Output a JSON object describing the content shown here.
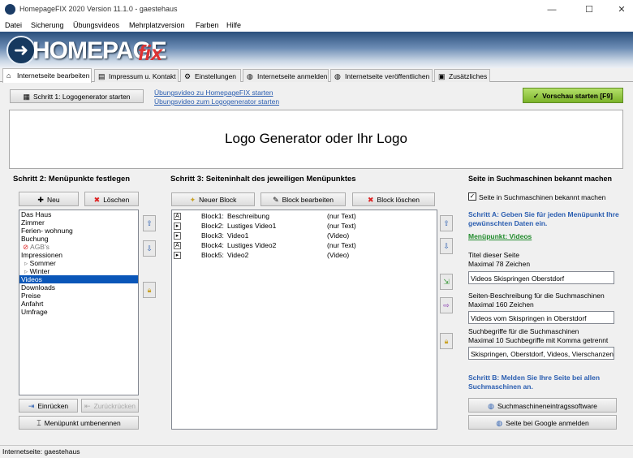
{
  "window": {
    "title": "HomepageFIX 2020 Version 11.1.0 - gaestehaus",
    "minimize": "—",
    "maximize": "☐",
    "close": "✕"
  },
  "menu": [
    "Datei",
    "Sicherung",
    "Übungsvideos",
    "Mehrplatzversion",
    "Farben",
    "Hilfe"
  ],
  "banner": {
    "logo": "HOMEPAGE",
    "logo_suffix": "fix"
  },
  "tabs": [
    "Internetseite bearbeiten",
    "Impressum u. Kontakt",
    "Einstellungen",
    "Internetseite anmelden",
    "Internetseite veröffentlichen",
    "Zusätzliches"
  ],
  "toolbar": {
    "step1": "Schritt 1: Logogenerator starten",
    "link1": "Übungsvideo zu HomepageFIX starten",
    "link2": "Übungsvideo zum Logogenerator starten",
    "preview": "Vorschau starten [F9]"
  },
  "logo_area": {
    "text": "Logo Generator oder Ihr Logo"
  },
  "step2": {
    "title": "Schritt 2: Menüpunkte festlegen",
    "new": "Neu",
    "delete": "Löschen",
    "items": [
      "Das Haus",
      "Zimmer",
      "Ferien- wohnung",
      "Buchung",
      "AGB's",
      "Impressionen",
      "Sommer",
      "Winter",
      "Videos",
      "Downloads",
      "Preise",
      "Anfahrt",
      "Umfrage"
    ],
    "indent": "Einrücken",
    "outdent": "Zurückrücken",
    "rename": "Menüpunkt umbenennen"
  },
  "step3": {
    "title": "Schritt 3: Seiteninhalt des jeweiligen Menüpunktes",
    "new_block": "Neuer Block",
    "edit_block": "Block bearbeiten",
    "delete_block": "Block löschen",
    "blocks": [
      {
        "icon": "A",
        "name": "Block1:",
        "title": "Beschreibung",
        "type": "(nur Text)"
      },
      {
        "icon": "▸",
        "name": "Block2:",
        "title": "Lustiges Video1",
        "type": "(nur Text)"
      },
      {
        "icon": "▸",
        "name": "Block3:",
        "title": "Video1",
        "type": "(Video)"
      },
      {
        "icon": "A",
        "name": "Block4:",
        "title": "Lustiges Video2",
        "type": "(nur Text)"
      },
      {
        "icon": "▸",
        "name": "Block5:",
        "title": "Video2",
        "type": "(Video)"
      }
    ]
  },
  "seo": {
    "title": "Seite in Suchmaschinen bekannt machen",
    "checkbox_label": "Seite in Suchmaschinen bekannt machen",
    "step_a": "Schritt A: Geben Sie für jeden Menüpunkt Ihre gewünschten Daten ein.",
    "menu_point": "Menüpunkt: Videos",
    "page_title_label1": "Titel dieser Seite",
    "page_title_label2": "Maximal 78 Zeichen",
    "page_title_value": "Videos Skispringen Oberstdorf",
    "desc_label1": "Seiten-Beschreibung für die Suchmaschinen",
    "desc_label2": "Maximal 160 Zeichen",
    "desc_value": "Videos vom Skispringen in Oberstdorf",
    "kw_label1": "Suchbegriffe für die Suchmaschinen",
    "kw_label2": "Maximal 10 Suchbegriffe mit Komma getrennt",
    "kw_value": "Skispringen, Oberstdorf, Videos, Vierschanzento",
    "step_b": "Schritt B: Melden Sie Ihre Seite bei allen Suchmaschinen an.",
    "submit_software": "Suchmaschineneintragssoftware",
    "google": "Seite bei Google anmelden"
  },
  "status": {
    "text": "Internetseite: gaestehaus"
  }
}
